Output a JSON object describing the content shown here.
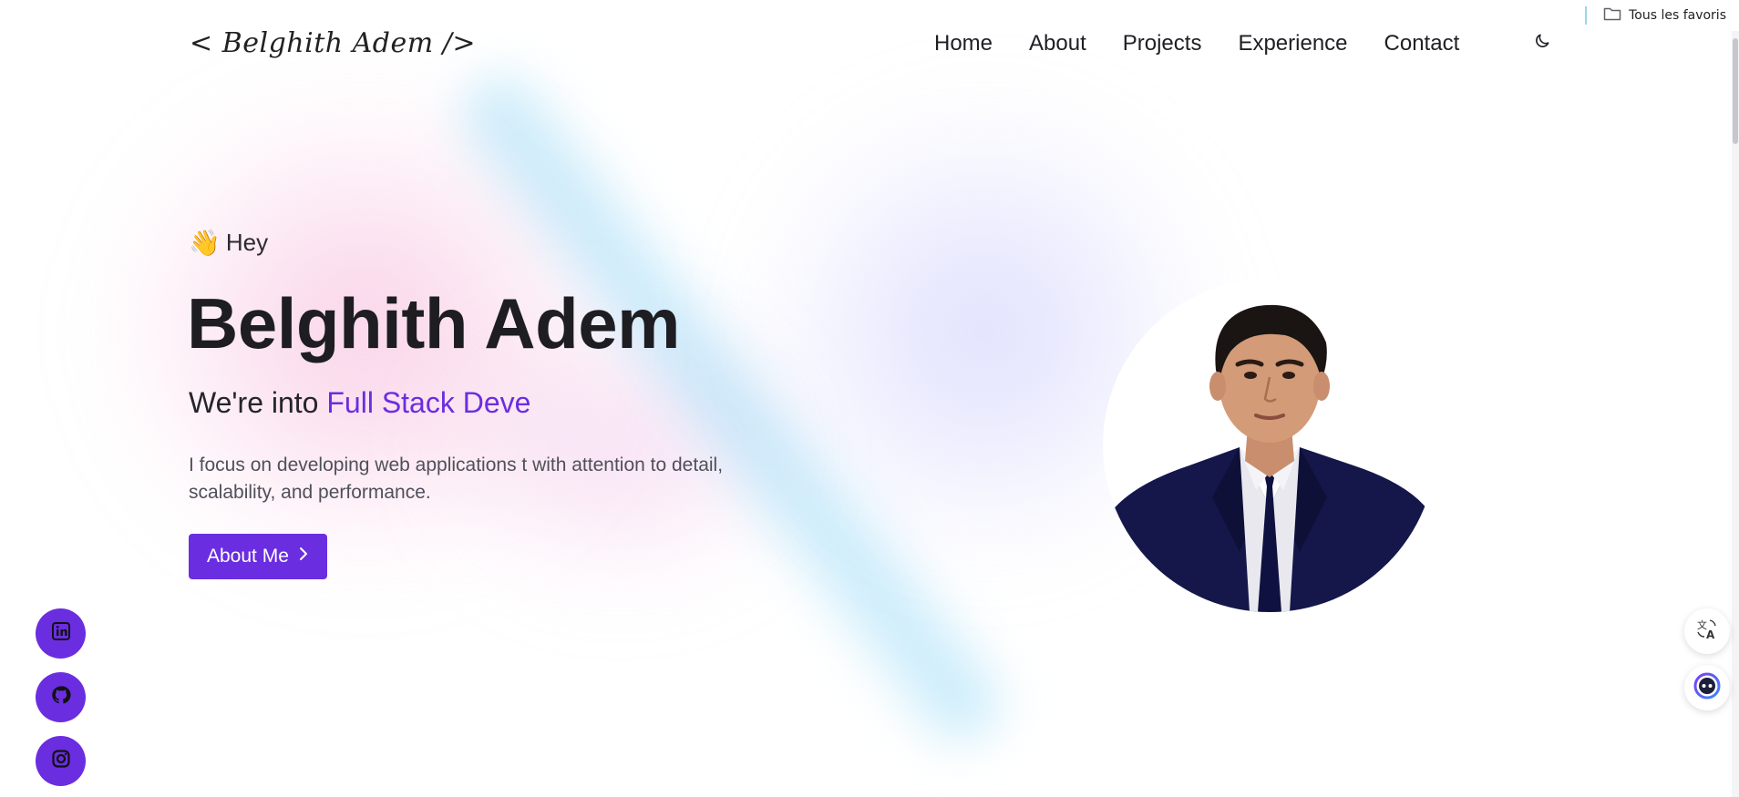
{
  "browser": {
    "bookmarks_folder_label": "Tous les favoris",
    "bookmarks_folder_icon": "folder-icon"
  },
  "header": {
    "logo_text": "< Belghith Adem />",
    "nav": [
      {
        "label": "Home"
      },
      {
        "label": "About"
      },
      {
        "label": "Projects"
      },
      {
        "label": "Experience"
      },
      {
        "label": "Contact"
      }
    ],
    "theme_toggle_icon": "moon-icon"
  },
  "hero": {
    "greeting_emoji": "👋",
    "greeting": "Hey",
    "name": "Belghith Adem",
    "tagline_prefix": "We're into",
    "tagline_highlight": "Full Stack Deve",
    "description": "I focus on developing web applications t with attention to detail, scalability, and performance.",
    "cta_label": "About Me",
    "cta_icon": "chevron-right-icon",
    "portrait_icon": "profile-photo"
  },
  "socials": [
    {
      "icon": "linkedin-icon"
    },
    {
      "icon": "github-icon"
    },
    {
      "icon": "instagram-icon"
    }
  ],
  "extensions": [
    {
      "icon": "translate-icon"
    },
    {
      "icon": "assistant-icon"
    }
  ],
  "colors": {
    "accent": "#6b2de0",
    "text_dark": "#1d1d22",
    "text_muted": "#50505a",
    "background": "#ffffff"
  }
}
